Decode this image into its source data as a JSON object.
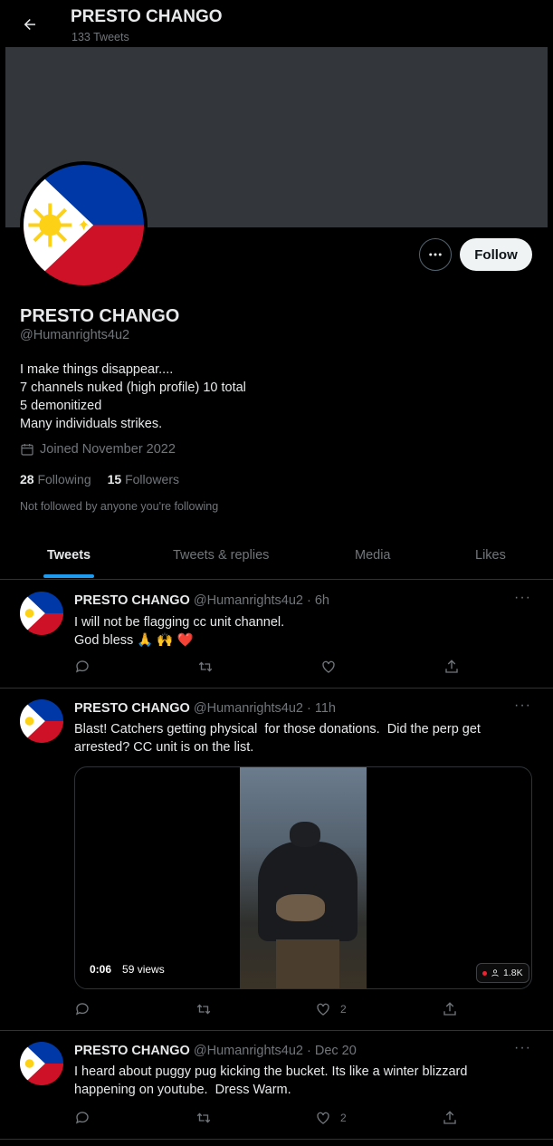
{
  "header": {
    "title": "PRESTO CHANGO",
    "subtitle": "133 Tweets"
  },
  "profile": {
    "name": "PRESTO CHANGO",
    "handle": "@Humanrights4u2",
    "follow_label": "Follow",
    "bio": [
      "I make things disappear....",
      "7 channels nuked (high profile) 10 total",
      "5 demonitized",
      "Many individuals strikes."
    ],
    "joined": "Joined November 2022",
    "following_count": "28",
    "following_label": "Following",
    "followers_count": "15",
    "followers_label": "Followers",
    "not_followed": "Not followed by anyone you're following"
  },
  "tabs": [
    "Tweets",
    "Tweets & replies",
    "Media",
    "Likes"
  ],
  "tweets": [
    {
      "name": "PRESTO CHANGO",
      "meta": "@Humanrights4u2 · 6h",
      "lines": [
        "I will not be flagging cc unit channel.",
        "God bless 🙏 🙌 ❤️"
      ],
      "likes": ""
    },
    {
      "name": "PRESTO CHANGO",
      "meta": "@Humanrights4u2 · 11h",
      "lines": [
        "Blast! Catchers getting physical  for those donations.  Did the perp get",
        "arrested? CC unit is on the list."
      ],
      "video_time": "0:06",
      "video_views": "59 views",
      "view_badge": "1.8K",
      "likes": "2"
    },
    {
      "name": "PRESTO CHANGO",
      "meta": "@Humanrights4u2 · Dec 20",
      "lines": [
        "I heard about puggy pug kicking the bucket. Its like a winter blizzard",
        "happening on youtube.  Dress Warm."
      ],
      "likes": "2"
    }
  ],
  "colors": {
    "accent": "#1d9bf0",
    "muted": "#71767b",
    "border": "#2f3336",
    "flag_blue": "#0038a8",
    "flag_red": "#ce1126",
    "flag_sun": "#fcd116"
  }
}
